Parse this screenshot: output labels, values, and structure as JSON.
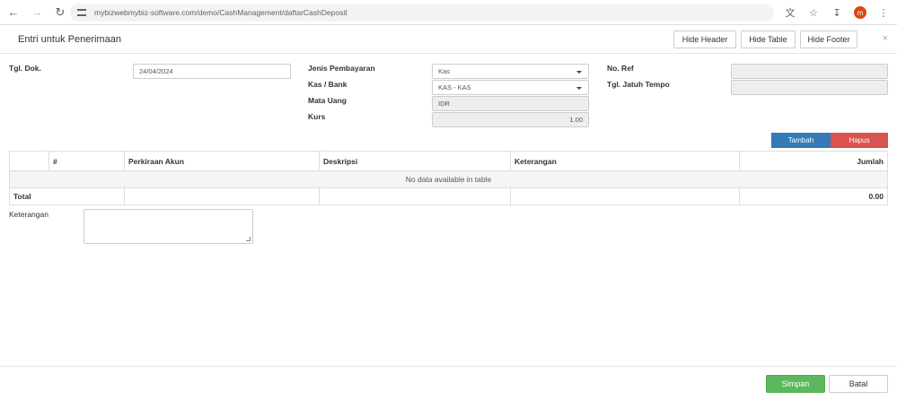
{
  "browser": {
    "url": "mybizwebmybiz-software.com/demo/CashManagement/daftarCashDeposit",
    "avatar_letter": "m"
  },
  "modal": {
    "title": "Entri untuk Penerimaan",
    "hide_header": "Hide Header",
    "hide_table": "Hide Table",
    "hide_footer": "Hide Footer",
    "close": "×"
  },
  "form": {
    "tgl_dok_label": "Tgl. Dok.",
    "tgl_dok_value": "24/04/2024",
    "jenis_label": "Jenis Pembayaran",
    "jenis_value": "Kas",
    "kas_bank_label": "Kas / Bank",
    "kas_bank_value": "KAS - KAS",
    "mata_uang_label": "Mata Uang",
    "mata_uang_value": "IDR",
    "kurs_label": "Kurs",
    "kurs_value": "1.00",
    "no_ref_label": "No. Ref",
    "no_ref_value": "",
    "jatuh_tempo_label": "Tgl. Jatuh Tempo",
    "jatuh_tempo_value": ""
  },
  "actions": {
    "tambah": "Tambah",
    "hapus": "Hapus"
  },
  "table": {
    "columns": [
      "#",
      "Perkiraan Akun",
      "Deskripsi",
      "Keterangan",
      "Jumlah"
    ],
    "empty_text": "No data available in table",
    "total_label": "Total",
    "total_value": "0.00"
  },
  "keterangan_label": "Keterangan",
  "footer": {
    "simpan": "Simpan",
    "batal": "Batal"
  }
}
